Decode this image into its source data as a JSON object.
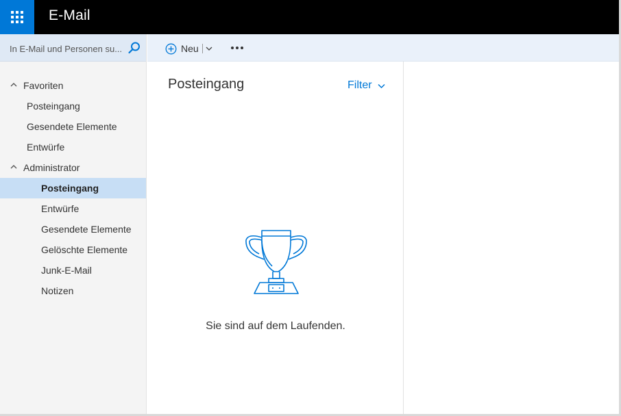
{
  "header": {
    "app_title": "E-Mail"
  },
  "search": {
    "placeholder": "In E-Mail und Personen su..."
  },
  "toolbar": {
    "new_label": "Neu"
  },
  "nav": {
    "favorites_label": "Favoriten",
    "favorites": [
      "Posteingang",
      "Gesendete Elemente",
      "Entwürfe"
    ],
    "account_label": "Administrator",
    "folders": [
      "Posteingang",
      "Entwürfe",
      "Gesendete Elemente",
      "Gelöschte Elemente",
      "Junk-E-Mail",
      "Notizen"
    ],
    "active_folder_index": 0
  },
  "list": {
    "title": "Posteingang",
    "filter_label": "Filter",
    "empty_message": "Sie sind auf dem Laufenden."
  },
  "colors": {
    "accent": "#0078d7",
    "topbar": "#000000",
    "selected": "#c7def5"
  },
  "icons": [
    "app-launcher-icon",
    "search-icon",
    "plus-icon",
    "chevron-down-icon",
    "more-icon",
    "chevron-up-icon",
    "trophy-icon"
  ]
}
